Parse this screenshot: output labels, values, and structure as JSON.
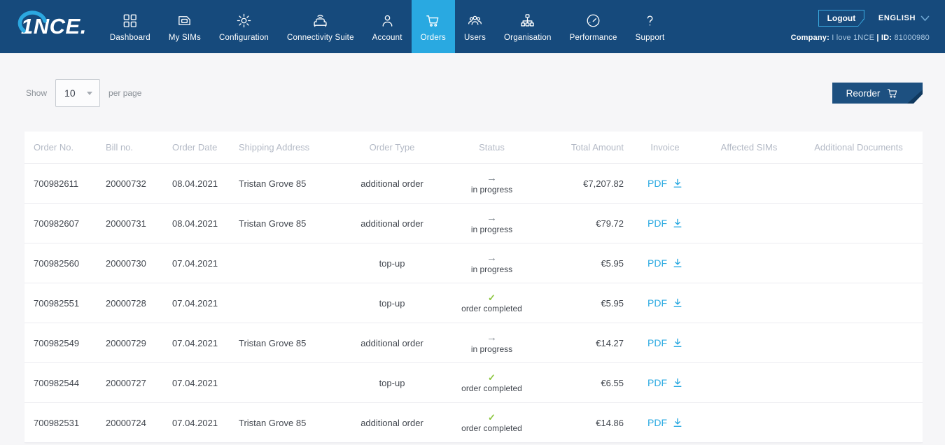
{
  "brand": {
    "logo_text": "1NCE.",
    "colors": {
      "navy": "#164A7C",
      "accent": "#29A9E1",
      "button_navy": "#1D5080",
      "success_green": "#8CC63F"
    }
  },
  "nav": {
    "items": [
      {
        "label": "Dashboard",
        "icon": "dashboard-icon",
        "active": false
      },
      {
        "label": "My SIMs",
        "icon": "sim-icon",
        "active": false
      },
      {
        "label": "Configuration",
        "icon": "gear-icon",
        "active": false
      },
      {
        "label": "Connectivity Suite",
        "icon": "connectivity-icon",
        "active": false
      },
      {
        "label": "Account",
        "icon": "person-icon",
        "active": false
      },
      {
        "label": "Orders",
        "icon": "cart-icon",
        "active": true
      },
      {
        "label": "Users",
        "icon": "users-icon",
        "active": false
      },
      {
        "label": "Organisation",
        "icon": "orgchart-icon",
        "active": false
      },
      {
        "label": "Performance",
        "icon": "gauge-icon",
        "active": false
      },
      {
        "label": "Support",
        "icon": "question-icon",
        "active": false
      }
    ]
  },
  "header_right": {
    "logout": "Logout",
    "language": "ENGLISH",
    "company_label": "Company:",
    "company_name": "I love 1NCE",
    "separator": "|",
    "id_label": "ID:",
    "id_value": "81000980"
  },
  "toolbar": {
    "show_label": "Show",
    "page_size": "10",
    "per_page_label": "per page",
    "reorder_label": "Reorder"
  },
  "table": {
    "columns": [
      "Order No.",
      "Bill no.",
      "Order Date",
      "Shipping Address",
      "Order Type",
      "Status",
      "Total Amount",
      "Invoice",
      "Affected SIMs",
      "Additional Documents"
    ],
    "status_icons": {
      "in_progress": "→",
      "completed": "✓"
    },
    "rows": [
      {
        "order_no": "700982611",
        "bill_no": "20000732",
        "order_date": "08.04.2021",
        "shipping_address": "Tristan Grove 85",
        "order_type": "additional order",
        "status": {
          "state": "in_progress",
          "label": "in progress"
        },
        "total_amount": "€7,207.82",
        "invoice": "PDF",
        "affected_sims": "",
        "additional_documents": ""
      },
      {
        "order_no": "700982607",
        "bill_no": "20000731",
        "order_date": "08.04.2021",
        "shipping_address": "Tristan Grove 85",
        "order_type": "additional order",
        "status": {
          "state": "in_progress",
          "label": "in progress"
        },
        "total_amount": "€79.72",
        "invoice": "PDF",
        "affected_sims": "",
        "additional_documents": ""
      },
      {
        "order_no": "700982560",
        "bill_no": "20000730",
        "order_date": "07.04.2021",
        "shipping_address": "",
        "order_type": "top-up",
        "status": {
          "state": "in_progress",
          "label": "in progress"
        },
        "total_amount": "€5.95",
        "invoice": "PDF",
        "affected_sims": "",
        "additional_documents": ""
      },
      {
        "order_no": "700982551",
        "bill_no": "20000728",
        "order_date": "07.04.2021",
        "shipping_address": "",
        "order_type": "top-up",
        "status": {
          "state": "completed",
          "label": "order completed"
        },
        "total_amount": "€5.95",
        "invoice": "PDF",
        "affected_sims": "",
        "additional_documents": ""
      },
      {
        "order_no": "700982549",
        "bill_no": "20000729",
        "order_date": "07.04.2021",
        "shipping_address": "Tristan Grove 85",
        "order_type": "additional order",
        "status": {
          "state": "in_progress",
          "label": "in progress"
        },
        "total_amount": "€14.27",
        "invoice": "PDF",
        "affected_sims": "",
        "additional_documents": ""
      },
      {
        "order_no": "700982544",
        "bill_no": "20000727",
        "order_date": "07.04.2021",
        "shipping_address": "",
        "order_type": "top-up",
        "status": {
          "state": "completed",
          "label": "order completed"
        },
        "total_amount": "€6.55",
        "invoice": "PDF",
        "affected_sims": "",
        "additional_documents": ""
      },
      {
        "order_no": "700982531",
        "bill_no": "20000724",
        "order_date": "07.04.2021",
        "shipping_address": "Tristan Grove 85",
        "order_type": "additional order",
        "status": {
          "state": "completed",
          "label": "order completed"
        },
        "total_amount": "€14.86",
        "invoice": "PDF",
        "affected_sims": "",
        "additional_documents": ""
      }
    ]
  }
}
